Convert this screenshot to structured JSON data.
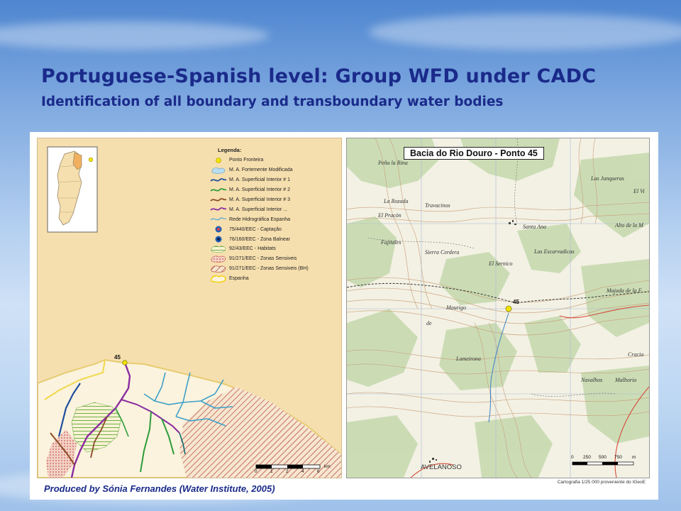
{
  "slide": {
    "title": "Portuguese-Spanish level: Group WFD under CADC",
    "subtitle": "Identification of all boundary and transboundary water bodies",
    "credit": "Produced by Sónia Fernandes (Water Institute, 2005)"
  },
  "left_map": {
    "legend_title": "Legenda:",
    "legend": [
      {
        "icon": "yellow-dot-icon",
        "label": "Ponto Fronteira",
        "color": "#f2e600"
      },
      {
        "icon": "light-blue-blob-icon",
        "label": "M. A. Fortemente Modificada",
        "color": "#b8dcf0"
      },
      {
        "icon": "blue-line-icon",
        "label": "M. A. Superficial Interior # 1",
        "color": "#1f4e9c"
      },
      {
        "icon": "green-line-icon",
        "label": "M. A. Superficial Interior # 2",
        "color": "#2e9c3a"
      },
      {
        "icon": "brown-line-icon",
        "label": "M. A. Superficial Interior # 3",
        "color": "#8a4a24"
      },
      {
        "icon": "purple-line-icon",
        "label": "M. A. Superficial Interior ...",
        "color": "#8a2ca0"
      },
      {
        "icon": "light-blue-line-icon",
        "label": "Rede Hidrográfica Espanha",
        "color": "#4aa8d8"
      },
      {
        "icon": "capture-point-icon",
        "label": "75/440/EEC - Captação",
        "color": "#c2184a"
      },
      {
        "icon": "bathing-zone-icon",
        "label": "76/160/EEC - Zona Balnear",
        "color": "#2a6fc0"
      },
      {
        "icon": "green-hatch-icon",
        "label": "92/43/EEC - Habitats",
        "color": "#8ac45a"
      },
      {
        "icon": "red-pattern-icon",
        "label": "91/271/EEC - Zonas Sensiveis",
        "color": "#d8766a"
      },
      {
        "icon": "brown-hatch-icon",
        "label": "91/271/EEC - Zonas Sensiveis (BH)",
        "color": "#a23a2e"
      },
      {
        "icon": "yellow-outline-icon",
        "label": "Espanha",
        "color": "#f2e600"
      }
    ],
    "point_label": "45",
    "scale_labels": [
      "0",
      "1",
      "2",
      "4",
      "6"
    ],
    "scale_unit": "km"
  },
  "right_map": {
    "title": "Bacia do Rio Douro - Ponto 45",
    "point_label": "45",
    "places": [
      "Peña la Rina",
      "Las Junqueras",
      "La Rozada",
      "Travacinos",
      "El Pracón",
      "Santa Ana",
      "Fajitales",
      "Sierra Cerdera",
      "Las Escarvadicas",
      "El Sernico",
      "Alto de la M",
      "Majada de la F",
      "Mourigo",
      "de",
      "Lameirona",
      "Navalhos",
      "Malhorio",
      "AVELANOSO",
      "Cracia",
      "El Vi"
    ],
    "scale_labels": [
      "0",
      "250",
      "500",
      "750",
      "m"
    ],
    "cartography_note": "Cartografia 1/25 000 proveniente do IGeoE"
  }
}
